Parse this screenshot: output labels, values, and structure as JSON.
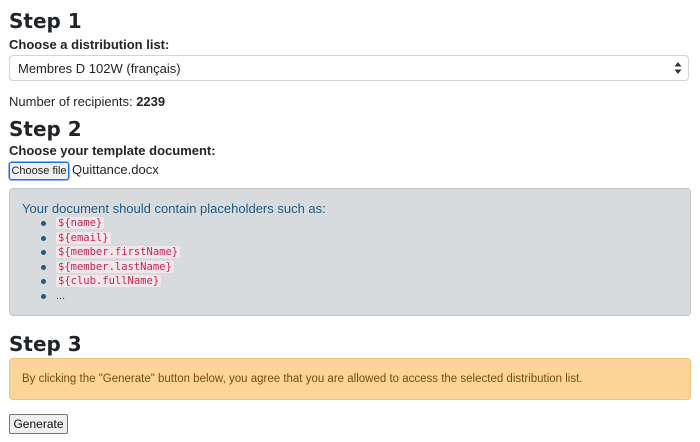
{
  "step1": {
    "heading": "Step 1",
    "label": "Choose a distribution list:",
    "selected_list": "Membres D 102W (français)",
    "recipients_label": "Number of recipients:",
    "recipients_count": "2239"
  },
  "step2": {
    "heading": "Step 2",
    "label": "Choose your template document:",
    "file_button": "Choose file",
    "file_name": "Quittance.docx",
    "info_intro": "Your document should contain placeholders such as:",
    "placeholders": [
      "${name}",
      "${email}",
      "${member.firstName}",
      "${member.lastName}",
      "${club.fullName}"
    ],
    "more": "..."
  },
  "step3": {
    "heading": "Step 3",
    "notice": "By clicking the \"Generate\" button below, you agree that you are allowed to access the selected distribution list.",
    "generate_button": "Generate"
  }
}
